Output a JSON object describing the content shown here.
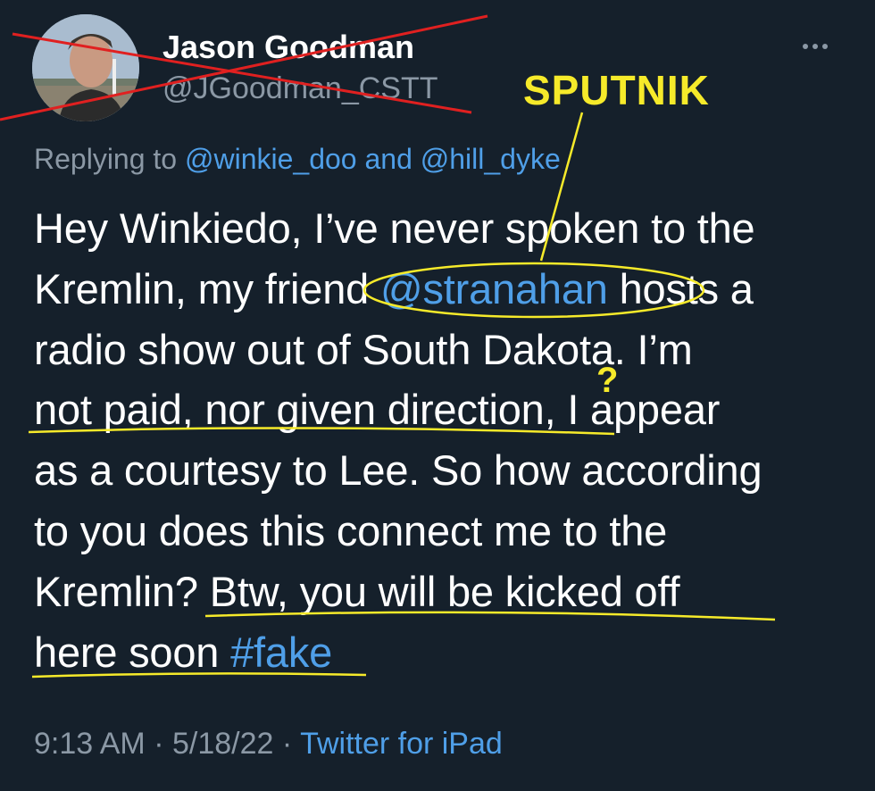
{
  "author": {
    "display_name": "Jason Goodman",
    "handle": "@JGoodman_CSTT"
  },
  "reply_context": {
    "prefix": "Replying to",
    "mention1": "@winkie_doo",
    "conjunction": "and",
    "mention2": "@hill_dyke"
  },
  "tweet": {
    "line1": "Hey Winkiedo, I’ve never spoken to the",
    "line2_a": "Kremlin, my friend ",
    "line2_mention": "@stranahan",
    "line2_b": " hosts a",
    "line3": "radio show out of South Dakota. I’m",
    "line4": "not paid, nor given direction, I appear",
    "line5": "as a courtesy to Lee. So how according",
    "line6": "to you does this connect me to the",
    "line7": "Kremlin? Btw, you will be kicked off",
    "line8_a": "here soon ",
    "line8_hashtag": "#fake"
  },
  "meta": {
    "time": "9:13 AM",
    "separator": "·",
    "date": "5/18/22",
    "source": "Twitter for iPad"
  },
  "annotations": {
    "label": "SPUTNIK",
    "question_mark": "?",
    "color": "#f6ea2a",
    "strike_color": "#e02020"
  },
  "colors": {
    "background": "#15202b",
    "link": "#4f9fe8",
    "secondary_text": "#8b98a5"
  },
  "icons": {
    "more": "more-horizontal-icon"
  }
}
